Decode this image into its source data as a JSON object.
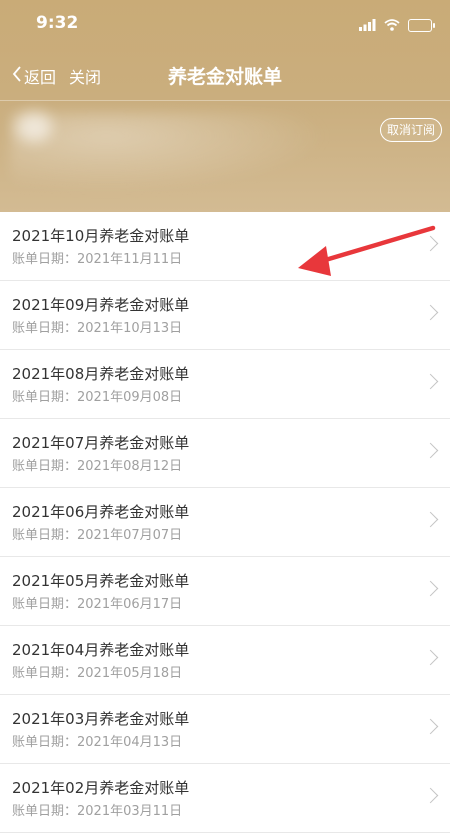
{
  "status_bar": {
    "time": "9:32"
  },
  "nav": {
    "back_label": "返回",
    "close_label": "关闭",
    "title": "养老金对账单"
  },
  "account": {
    "unsubscribe_label": "取消订阅"
  },
  "statements": [
    {
      "title": "2021年10月养老金对账单",
      "date": "账单日期：2021年11月11日"
    },
    {
      "title": "2021年09月养老金对账单",
      "date": "账单日期：2021年10月13日"
    },
    {
      "title": "2021年08月养老金对账单",
      "date": "账单日期：2021年09月08日"
    },
    {
      "title": "2021年07月养老金对账单",
      "date": "账单日期：2021年08月12日"
    },
    {
      "title": "2021年06月养老金对账单",
      "date": "账单日期：2021年07月07日"
    },
    {
      "title": "2021年05月养老金对账单",
      "date": "账单日期：2021年06月17日"
    },
    {
      "title": "2021年04月养老金对账单",
      "date": "账单日期：2021年05月18日"
    },
    {
      "title": "2021年03月养老金对账单",
      "date": "账单日期：2021年04月13日"
    },
    {
      "title": "2021年02月养老金对账单",
      "date": "账单日期：2021年03月11日"
    }
  ],
  "colors": {
    "header_gold": "#c9ab77",
    "annotation_red": "#e8373b"
  },
  "icons": [
    "wifi-icon",
    "signal-icon",
    "battery-icon",
    "back-chevron-icon",
    "chevron-right-icon",
    "annotation-arrow-icon"
  ]
}
